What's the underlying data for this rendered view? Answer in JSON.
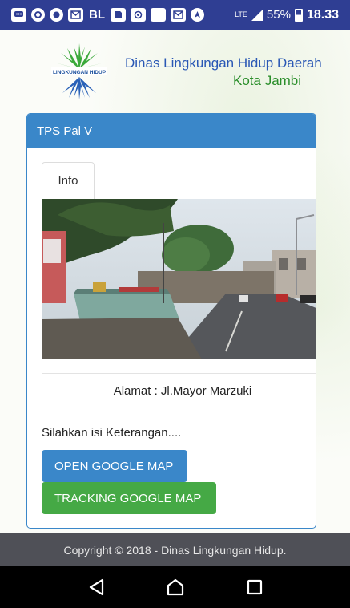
{
  "status_bar": {
    "icons": [
      "chat-icon",
      "app-icon",
      "app-icon",
      "gmail-icon",
      "BL",
      "sim-icon",
      "app-icon",
      "app-icon",
      "gmail-icon",
      "location-icon"
    ],
    "bl_text": "BL",
    "lte_label": "LTE",
    "battery": "55%",
    "time": "18.33"
  },
  "header": {
    "logo_text": "LINGKUNGAN HIDUP",
    "title_line1": "Dinas Lingkungan Hidup Daerah",
    "title_line2": "Kota Jambi"
  },
  "panel": {
    "title": "TPS Pal V",
    "tab_label": "Info",
    "address": "Alamat : Jl.Mayor Marzuki",
    "note": "Silahkan isi Keterangan....",
    "open_map_label": "OPEN GOOGLE MAP",
    "tracking_map_label": "TRACKING GOOGLE MAP"
  },
  "footer": {
    "copyright": "Copyright © 2018 - Dinas Lingkungan Hidup."
  },
  "colors": {
    "status_bar": "#2f3e93",
    "panel_primary": "#3a87c9",
    "success": "#45a945",
    "footer": "#4f5057"
  }
}
